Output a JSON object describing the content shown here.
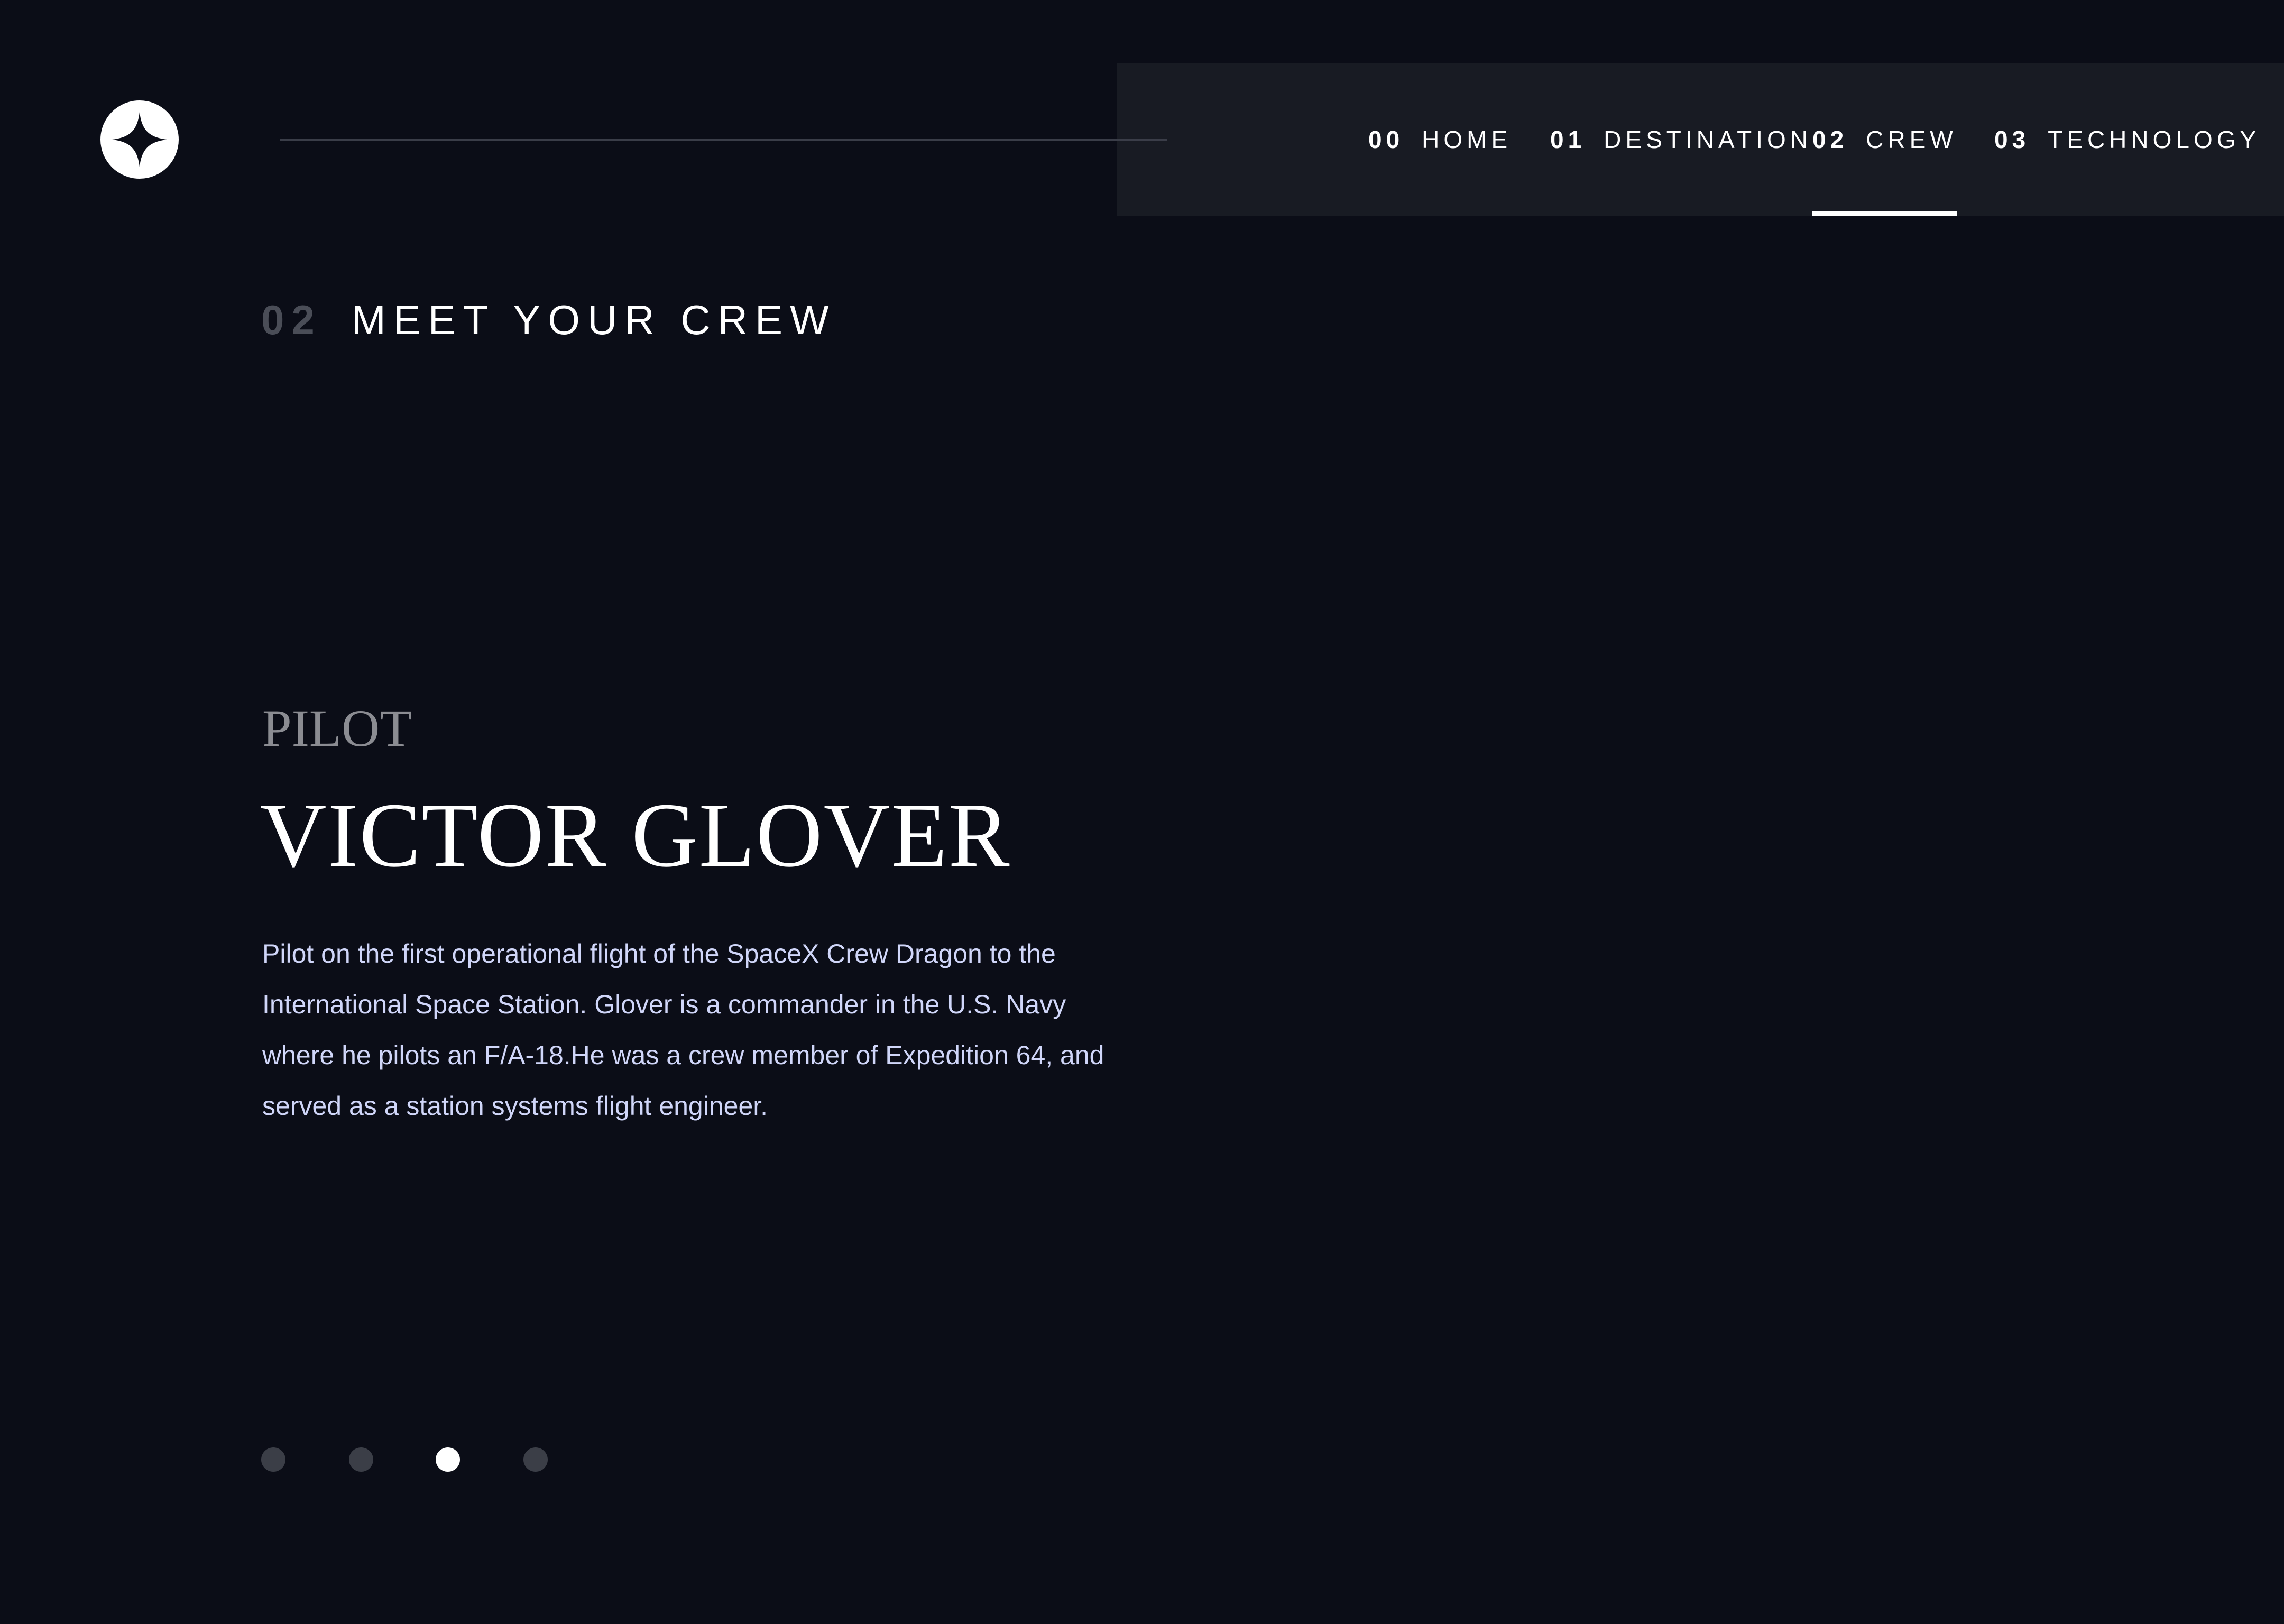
{
  "header": {
    "logo_icon": "star-logo-icon"
  },
  "nav": {
    "items": [
      {
        "num": "00",
        "label": "HOME",
        "active": false
      },
      {
        "num": "01",
        "label": "DESTINATION",
        "active": false
      },
      {
        "num": "02",
        "label": "CREW",
        "active": true
      },
      {
        "num": "03",
        "label": "TECHNOLOGY",
        "active": false
      }
    ]
  },
  "page": {
    "heading_num": "02",
    "heading": "MEET YOUR CREW"
  },
  "crew": {
    "role": "PILOT",
    "name": "VICTOR GLOVER",
    "bio": "Pilot on the first operational flight of the SpaceX Crew Dragon to the International Space Station. Glover is a commander in the U.S. Navy where he pilots an F/A-18.He was a crew member of Expedition 64, and served as a station systems flight engineer."
  },
  "carousel": {
    "count": 4,
    "active_index": 2
  },
  "colors": {
    "background": "#0b0d17",
    "nav_background": "#181b23",
    "accent": "#ffffff",
    "muted_text": "#8b8c92",
    "body_text": "#d0d6f9",
    "inactive_dot": "#3b3e47"
  }
}
